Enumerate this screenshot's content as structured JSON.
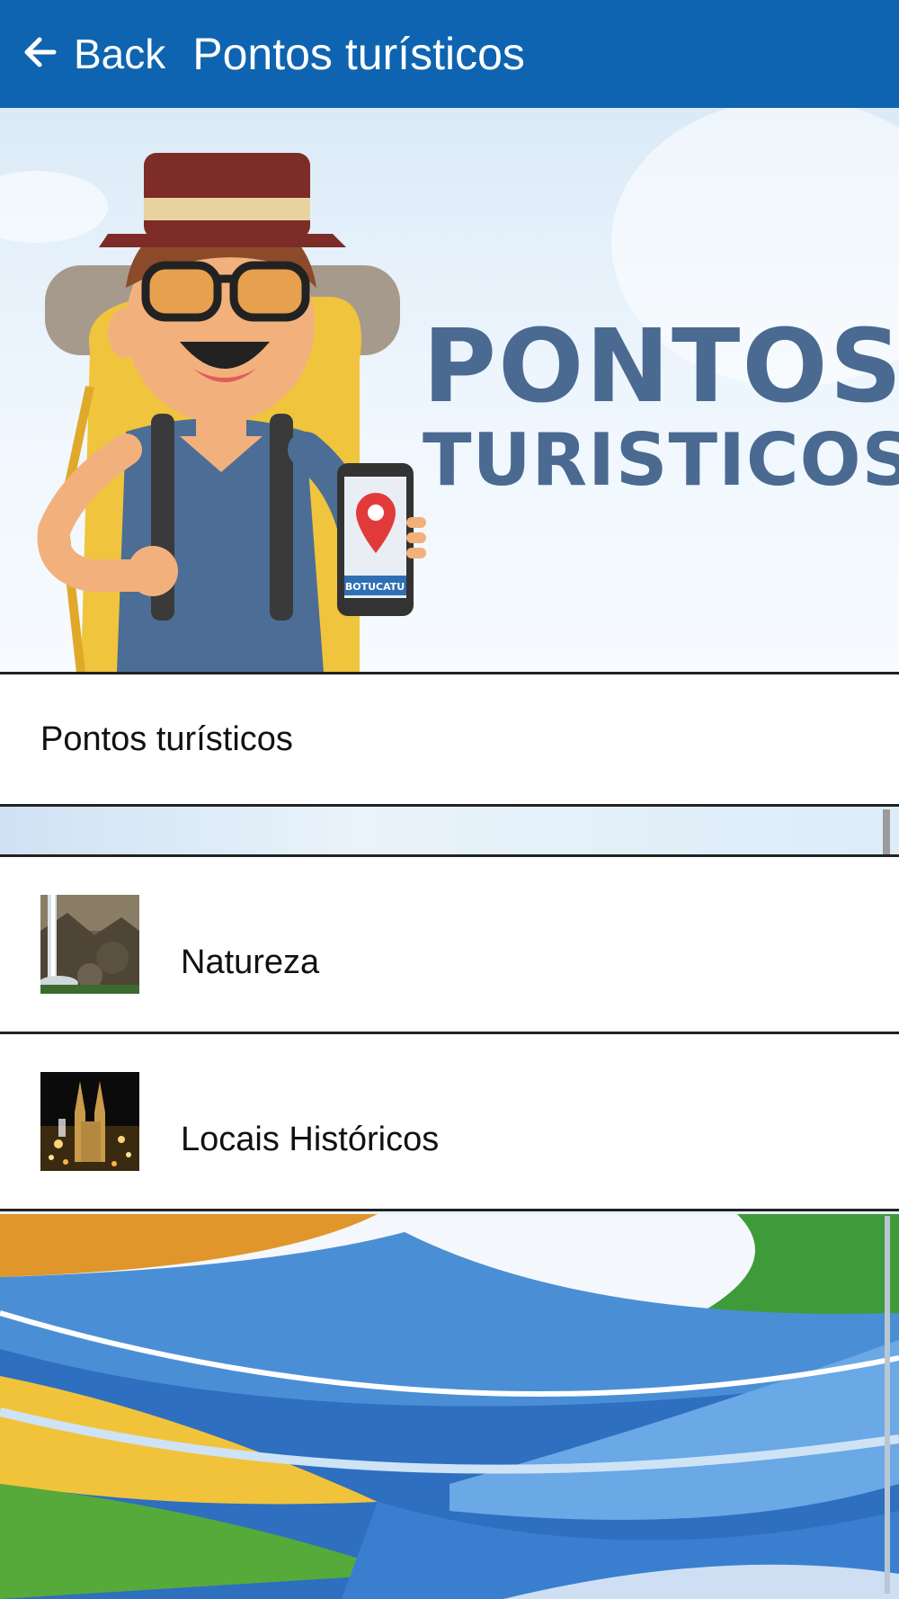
{
  "app_bar": {
    "back_label": "Back",
    "title": "Pontos turísticos",
    "background_color": "#0e64b0"
  },
  "hero": {
    "line1": "PONTOS",
    "line2": "TURISTICOS",
    "phone_label": "BOTUCATU",
    "text_color": "#4a6a91"
  },
  "section": {
    "label": "Pontos turísticos"
  },
  "list": {
    "items": [
      {
        "label": "Natureza",
        "thumbnail": "waterfall-photo"
      },
      {
        "label": "Locais Históricos",
        "thumbnail": "cathedral-night-photo"
      }
    ]
  },
  "icons": {
    "back": "arrow-left-icon"
  }
}
